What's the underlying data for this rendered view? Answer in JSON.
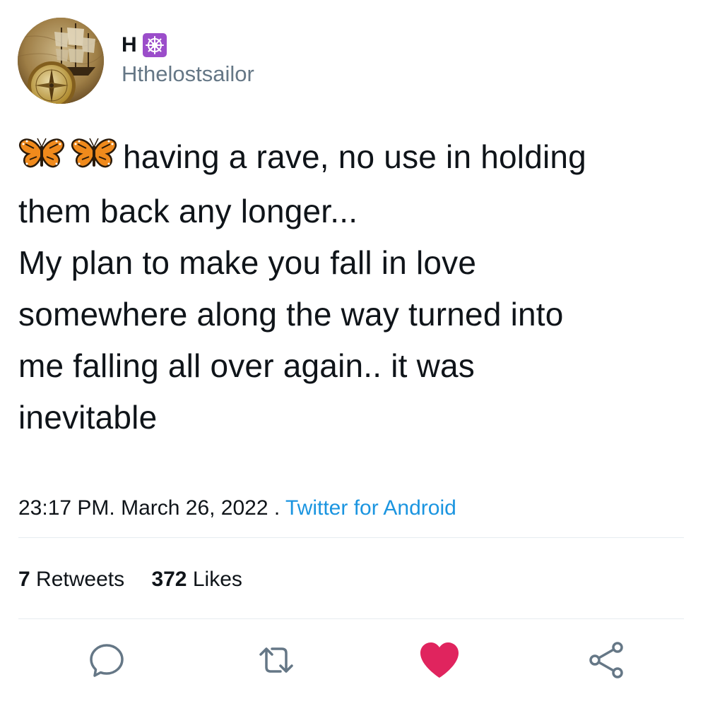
{
  "user": {
    "display_name": "H",
    "name_badge": "wheel-of-dharma-emoji",
    "handle": "Hthelostsailor"
  },
  "tweet": {
    "emoji": [
      "butterfly",
      "butterfly"
    ],
    "lines": [
      "having a rave, no use in holding",
      "them back any longer...",
      "My plan to make you fall in love",
      "somewhere along the way turned into",
      "me falling all over again.. it was",
      "inevitable"
    ]
  },
  "meta": {
    "time": "23:17 PM. March 26, 2022 .",
    "source": "Twitter for Android"
  },
  "stats": {
    "retweets_count": "7",
    "retweets_label": "Retweets",
    "likes_count": "372",
    "likes_label": "Likes"
  },
  "actions": {
    "reply_icon": "reply-icon",
    "retweet_icon": "retweet-icon",
    "like_icon": "heart-icon",
    "share_icon": "share-icon",
    "like_active": true
  },
  "colors": {
    "text": "#0f1419",
    "secondary": "#657786",
    "link": "#1b95e0",
    "like": "#e0245e",
    "icon": "#657786",
    "divider": "#e6ecf0"
  }
}
